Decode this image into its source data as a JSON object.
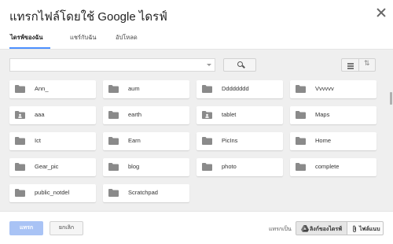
{
  "dialog": {
    "title": "แทรกไฟล์โดยใช้ Google ไดรฟ์"
  },
  "tabs": [
    {
      "label": "ไดรฟ์ของฉัน",
      "active": true
    },
    {
      "label": "แชร์กับฉัน",
      "active": false
    },
    {
      "label": "อัปโหลด",
      "active": false
    }
  ],
  "search": {
    "value": "",
    "placeholder": ""
  },
  "folders": [
    {
      "label": "Ann_",
      "icon": "folder-icon"
    },
    {
      "label": "aum",
      "icon": "folder-icon"
    },
    {
      "label": "Dddddddd",
      "icon": "folder-icon"
    },
    {
      "label": "Vvvvvv",
      "icon": "folder-icon"
    },
    {
      "label": "aaa",
      "icon": "shared-folder-icon"
    },
    {
      "label": "earth",
      "icon": "folder-icon"
    },
    {
      "label": "tablet",
      "icon": "shared-folder-icon"
    },
    {
      "label": "Maps",
      "icon": "folder-icon"
    },
    {
      "label": "Ict",
      "icon": "folder-icon"
    },
    {
      "label": "Earn",
      "icon": "folder-icon"
    },
    {
      "label": "PicIns",
      "icon": "folder-icon"
    },
    {
      "label": "Home",
      "icon": "folder-icon"
    },
    {
      "label": "Gear_pic",
      "icon": "folder-icon"
    },
    {
      "label": "blog",
      "icon": "folder-icon"
    },
    {
      "label": "photo",
      "icon": "folder-icon"
    },
    {
      "label": "complete",
      "icon": "folder-icon"
    },
    {
      "label": "public_notdel",
      "icon": "folder-icon"
    },
    {
      "label": "Scratchpad",
      "icon": "folder-icon"
    }
  ],
  "footer": {
    "insert_label": "แทรก",
    "cancel_label": "ยกเลิก",
    "insert_as_label": "แทรกเป็น",
    "drive_link_label": "ลิงก์ของไดรฟ์",
    "attachment_label": "ไฟล์แนบ"
  },
  "colors": {
    "accent": "#4d90fe",
    "insert_button": "#a9c3f5",
    "folder_icon": "#8a8a8a",
    "background_gray": "#efefef"
  }
}
